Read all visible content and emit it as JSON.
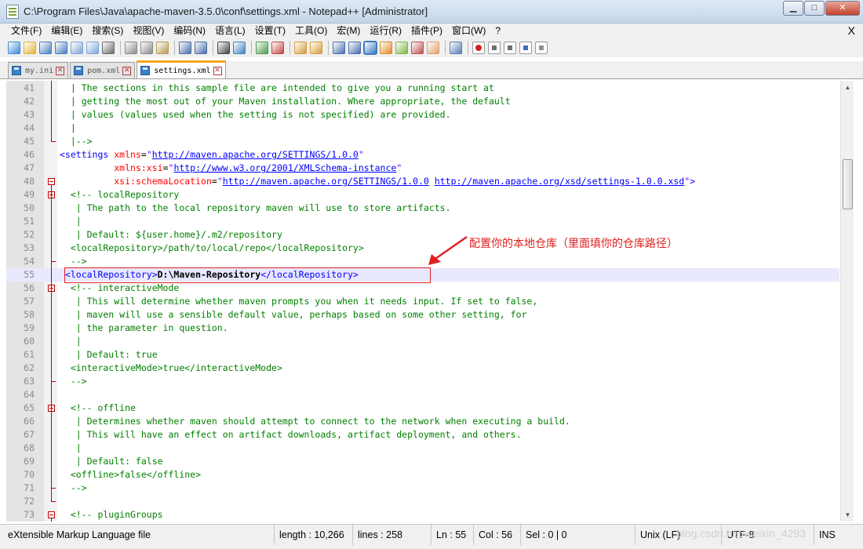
{
  "window": {
    "title": "C:\\Program Files\\Java\\apache-maven-3.5.0\\conf\\settings.xml - Notepad++ [Administrator]",
    "minimize": "▁",
    "maximize": "□",
    "close": "✕"
  },
  "menu": {
    "items": [
      "文件(F)",
      "编辑(E)",
      "搜索(S)",
      "视图(V)",
      "编码(N)",
      "语言(L)",
      "设置(T)",
      "工具(O)",
      "宏(M)",
      "运行(R)",
      "插件(P)",
      "窗口(W)",
      "?"
    ],
    "close_doc": "X"
  },
  "toolbar": {
    "icons": [
      "new-file-icon",
      "open-file-icon",
      "save-icon",
      "save-all-icon",
      "close-icon",
      "close-all-icon",
      "print-icon",
      "cut-icon",
      "copy-icon",
      "paste-icon",
      "undo-icon",
      "redo-icon",
      "find-icon",
      "replace-icon",
      "zoom-in-icon",
      "zoom-out-icon",
      "sync-vertical-icon",
      "sync-horizontal-icon",
      "word-wrap-icon",
      "show-all-chars-icon",
      "indent-guide-icon",
      "user-lang-icon",
      "doc-map-icon",
      "function-list-icon",
      "folder-workspace-icon",
      "monitor-icon",
      "record-macro-icon",
      "stop-macro-icon",
      "play-macro-icon",
      "run-macro-multiple-icon",
      "save-macro-icon"
    ]
  },
  "tabs": [
    {
      "label": "my.ini",
      "active": false
    },
    {
      "label": "pom.xml",
      "active": false
    },
    {
      "label": "settings.xml",
      "active": true
    }
  ],
  "editor": {
    "current_line": 55,
    "lines": [
      {
        "n": "41",
        "segs": [
          [
            "c-comment",
            "  | The sections in this sample file are intended to give you a running start at"
          ]
        ]
      },
      {
        "n": "42",
        "segs": [
          [
            "c-comment",
            "  | getting the most out of your Maven installation. Where appropriate, the default"
          ]
        ]
      },
      {
        "n": "43",
        "segs": [
          [
            "c-comment",
            "  | values (values used when the setting is not specified) are provided."
          ]
        ]
      },
      {
        "n": "44",
        "segs": [
          [
            "c-comment",
            "  |"
          ]
        ]
      },
      {
        "n": "45",
        "segs": [
          [
            "c-comment",
            "  |-->"
          ]
        ]
      },
      {
        "n": "46",
        "segs": [
          [
            "c-tag",
            "<settings "
          ],
          [
            "c-attr",
            "xmlns"
          ],
          [
            "c-text",
            "="
          ],
          [
            "c-val",
            "\""
          ],
          [
            "c-url",
            "http://maven.apache.org/SETTINGS/1.0.0"
          ],
          [
            "c-val",
            "\""
          ]
        ]
      },
      {
        "n": "47",
        "segs": [
          [
            "c-text",
            "          "
          ],
          [
            "c-attr",
            "xmlns:xsi"
          ],
          [
            "c-text",
            "="
          ],
          [
            "c-val",
            "\""
          ],
          [
            "c-url",
            "http://www.w3.org/2001/XMLSchema-instance"
          ],
          [
            "c-val",
            "\""
          ]
        ]
      },
      {
        "n": "48",
        "segs": [
          [
            "c-text",
            "          "
          ],
          [
            "c-attr",
            "xsi:schemaLocation"
          ],
          [
            "c-text",
            "="
          ],
          [
            "c-val",
            "\""
          ],
          [
            "c-url",
            "http://maven.apache.org/SETTINGS/1.0.0"
          ],
          [
            "c-val",
            " "
          ],
          [
            "c-url",
            "http://maven.apache.org/xsd/settings-1.0.0.xsd"
          ],
          [
            "c-val",
            "\""
          ],
          [
            "c-tag",
            ">"
          ]
        ]
      },
      {
        "n": "49",
        "segs": [
          [
            "c-comment",
            "  <!-- localRepository"
          ]
        ]
      },
      {
        "n": "50",
        "segs": [
          [
            "c-comment",
            "   | The path to the local repository maven will use to store artifacts."
          ]
        ]
      },
      {
        "n": "51",
        "segs": [
          [
            "c-comment",
            "   |"
          ]
        ]
      },
      {
        "n": "52",
        "segs": [
          [
            "c-comment",
            "   | Default: ${user.home}/.m2/repository"
          ]
        ]
      },
      {
        "n": "53",
        "segs": [
          [
            "c-comment",
            "  <localRepository>/path/to/local/repo</localRepository>"
          ]
        ]
      },
      {
        "n": "54",
        "segs": [
          [
            "c-comment",
            "  -->"
          ]
        ]
      },
      {
        "n": "55",
        "segs": [
          [
            "c-tag",
            " <localRepository>"
          ],
          [
            "c-bold",
            "D:\\Maven-Repository"
          ],
          [
            "c-tag",
            "</localRepository>"
          ]
        ]
      },
      {
        "n": "56",
        "segs": [
          [
            "c-comment",
            "  <!-- interactiveMode"
          ]
        ]
      },
      {
        "n": "57",
        "segs": [
          [
            "c-comment",
            "   | This will determine whether maven prompts you when it needs input. If set to false,"
          ]
        ]
      },
      {
        "n": "58",
        "segs": [
          [
            "c-comment",
            "   | maven will use a sensible default value, perhaps based on some other setting, for"
          ]
        ]
      },
      {
        "n": "59",
        "segs": [
          [
            "c-comment",
            "   | the parameter in question."
          ]
        ]
      },
      {
        "n": "60",
        "segs": [
          [
            "c-comment",
            "   |"
          ]
        ]
      },
      {
        "n": "61",
        "segs": [
          [
            "c-comment",
            "   | Default: true"
          ]
        ]
      },
      {
        "n": "62",
        "segs": [
          [
            "c-comment",
            "  <interactiveMode>true</interactiveMode>"
          ]
        ]
      },
      {
        "n": "63",
        "segs": [
          [
            "c-comment",
            "  -->"
          ]
        ]
      },
      {
        "n": "64",
        "segs": [
          [
            "c-text",
            ""
          ]
        ]
      },
      {
        "n": "65",
        "segs": [
          [
            "c-comment",
            "  <!-- offline"
          ]
        ]
      },
      {
        "n": "66",
        "segs": [
          [
            "c-comment",
            "   | Determines whether maven should attempt to connect to the network when executing a build."
          ]
        ]
      },
      {
        "n": "67",
        "segs": [
          [
            "c-comment",
            "   | This will have an effect on artifact downloads, artifact deployment, and others."
          ]
        ]
      },
      {
        "n": "68",
        "segs": [
          [
            "c-comment",
            "   |"
          ]
        ]
      },
      {
        "n": "69",
        "segs": [
          [
            "c-comment",
            "   | Default: false"
          ]
        ]
      },
      {
        "n": "70",
        "segs": [
          [
            "c-comment",
            "  <offline>false</offline>"
          ]
        ]
      },
      {
        "n": "71",
        "segs": [
          [
            "c-comment",
            "  -->"
          ]
        ]
      },
      {
        "n": "72",
        "segs": [
          [
            "c-text",
            ""
          ]
        ]
      },
      {
        "n": "73",
        "segs": [
          [
            "c-comment",
            "  <!-- pluginGroups"
          ]
        ]
      }
    ],
    "fold_markers": [
      "48",
      "49",
      "56",
      "65",
      "73"
    ]
  },
  "annotation": {
    "text": "配置你的本地仓库（里面填你的仓库路径）",
    "color": "#e02020"
  },
  "statusbar": {
    "file_type": "eXtensible Markup Language file",
    "length": "length : 10,266",
    "lines": "lines : 258",
    "ln": "Ln : 55",
    "col": "Col : 56",
    "sel": "Sel : 0 | 0",
    "eol": "Unix (LF)",
    "encoding": "UTF-8",
    "mode": "INS",
    "watermark": "blog.csdn.net/weixin_4293"
  },
  "colors": {
    "comment": "#008000",
    "tag": "#0000ff",
    "attribute": "#ff0000",
    "current_line_bg": "#e8e8ff",
    "active_tab_accent": "#f3a61c"
  }
}
